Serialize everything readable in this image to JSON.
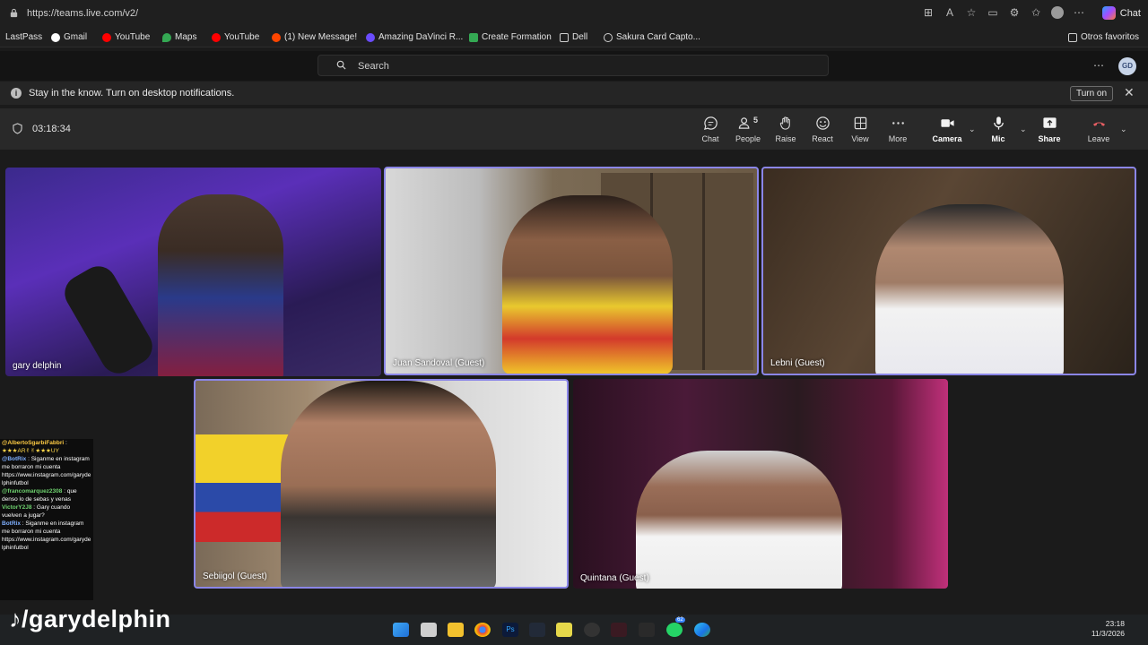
{
  "browser": {
    "url": "https://teams.live.com/v2/",
    "chat_label": "Chat",
    "bookmarks": [
      {
        "label": "LastPass",
        "color": "#c8102e"
      },
      {
        "label": "Gmail",
        "color": "#ea4335"
      },
      {
        "label": "YouTube",
        "color": "#ff0000"
      },
      {
        "label": "Maps",
        "color": "#34a853"
      },
      {
        "label": "YouTube",
        "color": "#ff0000"
      },
      {
        "label": "(1) New Message!",
        "color": "#ff4500"
      },
      {
        "label": "Amazing DaVinci R...",
        "color": "#6a4cff"
      },
      {
        "label": "Create Formation",
        "color": "#34a853"
      },
      {
        "label": "Dell",
        "color": "#9aa0a6"
      },
      {
        "label": "Sakura Card Capto...",
        "color": "#9aa0a6"
      }
    ],
    "other_favorites": "Otros favoritos"
  },
  "teams": {
    "search_placeholder": "Search",
    "avatar_initials": "GD",
    "notification": {
      "text": "Stay in the know. Turn on desktop notifications.",
      "button": "Turn on"
    },
    "meeting": {
      "timer": "03:18:34",
      "people_count": "5",
      "controls": {
        "chat": "Chat",
        "people": "People",
        "raise": "Raise",
        "react": "React",
        "view": "View",
        "more": "More",
        "camera": "Camera",
        "mic": "Mic",
        "share": "Share",
        "leave": "Leave"
      },
      "participants": [
        {
          "name": "gary delphin"
        },
        {
          "name": "Juan Sandoval (Guest)"
        },
        {
          "name": "Lebni (Guest)"
        },
        {
          "name": "Sebiigol (Guest)"
        },
        {
          "name": "Quintana (Guest)"
        }
      ]
    }
  },
  "stream_chat": {
    "lines": [
      {
        "user": "@AlbertoSgarbiFabbri",
        "text": ":"
      },
      {
        "user": "",
        "text": "★★★AR✌✌★★★UY"
      },
      {
        "user": "@BotRix",
        "text": ": Siganme en instagram me borraron mi cuenta"
      },
      {
        "user": "",
        "text": "https://www.instagram.com/garydelphinfutbol"
      },
      {
        "user": "@francomarquez2308",
        "text": ": que denso lo de sebas y venas"
      },
      {
        "user": "VictorY2J8",
        "text": ": Gary cuando vuelven a jugar?"
      },
      {
        "user": "BotRix",
        "text": ": Siganme en instagram me borraron mi cuenta"
      },
      {
        "user": "",
        "text": "https://www.instagram.com/garydelphinfutbol"
      }
    ],
    "watermark": "/garydelphin"
  },
  "taskbar": {
    "time": "23:18",
    "date": "11/3/2026",
    "badge": "62"
  }
}
